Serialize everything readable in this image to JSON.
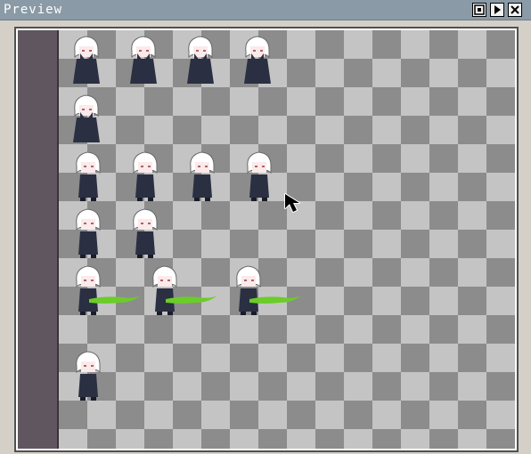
{
  "window": {
    "title": "Preview",
    "buttons": [
      {
        "name": "menu",
        "icon": "grid-menu-icon"
      },
      {
        "name": "play",
        "icon": "play-icon"
      },
      {
        "name": "close",
        "icon": "close-icon"
      }
    ]
  },
  "colors": {
    "titlebar": "#8a9aa6",
    "checker_light": "#c4c4c4",
    "checker_dark": "#8c8c8c",
    "left_bar": "#5f5660",
    "hair": "#ffffff",
    "cloak": "#2a2f42",
    "slash": "#6ccc2a"
  },
  "sprite_rows": [
    {
      "frames": 4,
      "pose": "front-hands"
    },
    {
      "frames": 1,
      "pose": "front-hands"
    },
    {
      "frames": 4,
      "pose": "side"
    },
    {
      "frames": 2,
      "pose": "side"
    },
    {
      "frames": 3,
      "pose": "attack"
    },
    {
      "frames": 1,
      "pose": "side"
    }
  ],
  "cursor": {
    "icon": "arrow-cursor-icon"
  }
}
